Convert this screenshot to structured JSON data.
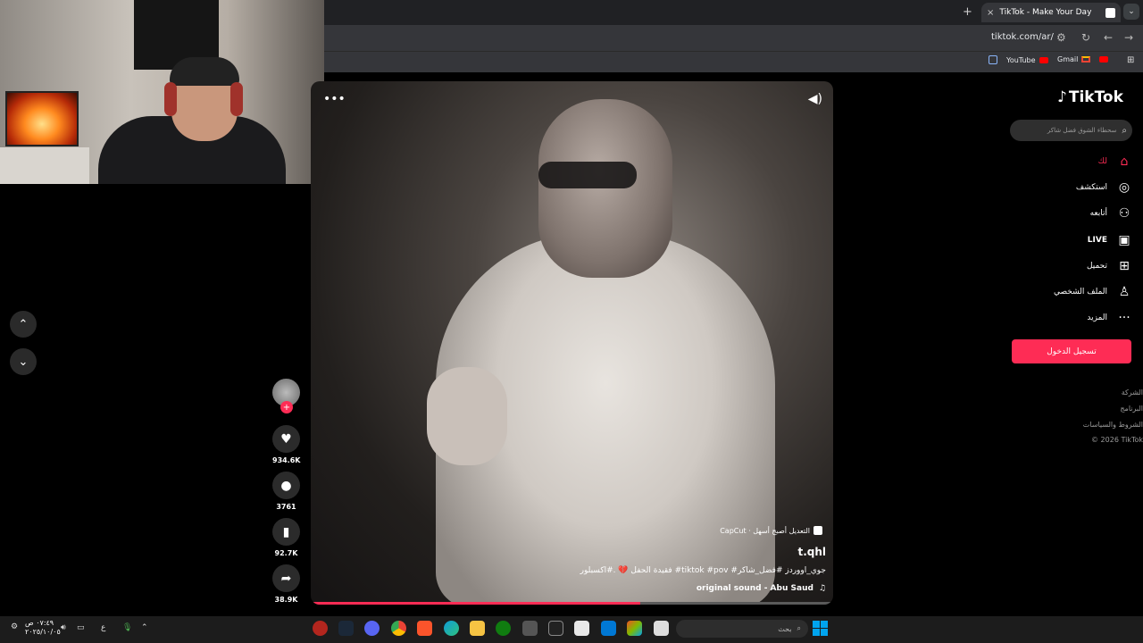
{
  "browser": {
    "tab_title": "TikTok - Make Your Day",
    "tab_close": "×",
    "new_tab": "+",
    "tab_menu": "⌄",
    "url": "tiktok.com/ar/",
    "bookmarks": [
      {
        "label": "YouTube"
      },
      {
        "label": "Gmail"
      }
    ]
  },
  "left_nav": {
    "up": "⌃",
    "down": "⌄"
  },
  "video": {
    "more": "•••",
    "volume": "◀)",
    "capcut_text": "CapCut · التعديل أصبح أسهل",
    "author": "t.qhl",
    "caption": "فقيدة الحفل 💔 .#اكسبلور #tiktok #pov #جوي_اووردز #فضل_شاكر",
    "sound_note": "♫",
    "sound": "original sound - Abu Saud",
    "progress": 0.63
  },
  "actions": {
    "avatar_plus": "+",
    "likes": "934.6K",
    "comments": "3761",
    "saves": "92.7K",
    "shares": "38.9K"
  },
  "sidebar": {
    "logo": "TikTok",
    "search_placeholder": "سحطاء الشوق فضل شاكر",
    "items": [
      {
        "label": "لك",
        "icon": "home-icon",
        "glyph": "⌂"
      },
      {
        "label": "استكشف",
        "icon": "compass-icon",
        "glyph": "◎"
      },
      {
        "label": "أتابعه",
        "icon": "following-icon",
        "glyph": "⚇"
      },
      {
        "label": "LIVE",
        "icon": "live-icon",
        "glyph": "▣"
      },
      {
        "label": "تحميل",
        "icon": "upload-icon",
        "glyph": "⊞"
      },
      {
        "label": "الملف الشخصي",
        "icon": "profile-icon",
        "glyph": "♙"
      },
      {
        "label": "المزيد",
        "icon": "more-icon",
        "glyph": "···"
      }
    ],
    "login": "تسجيل الدخول",
    "footer": [
      "الشركة",
      "البرنامج",
      "الشروط والسياسات",
      "© 2026 TikTok"
    ]
  },
  "taskbar": {
    "search_placeholder": "بحث",
    "time": "٠٧:٤٩ ص",
    "date": "٢٠٢٥/١٠/٠٥",
    "lang": "ع"
  },
  "colors": {
    "accent": "#fe2c55",
    "chrome": "#35363a"
  }
}
